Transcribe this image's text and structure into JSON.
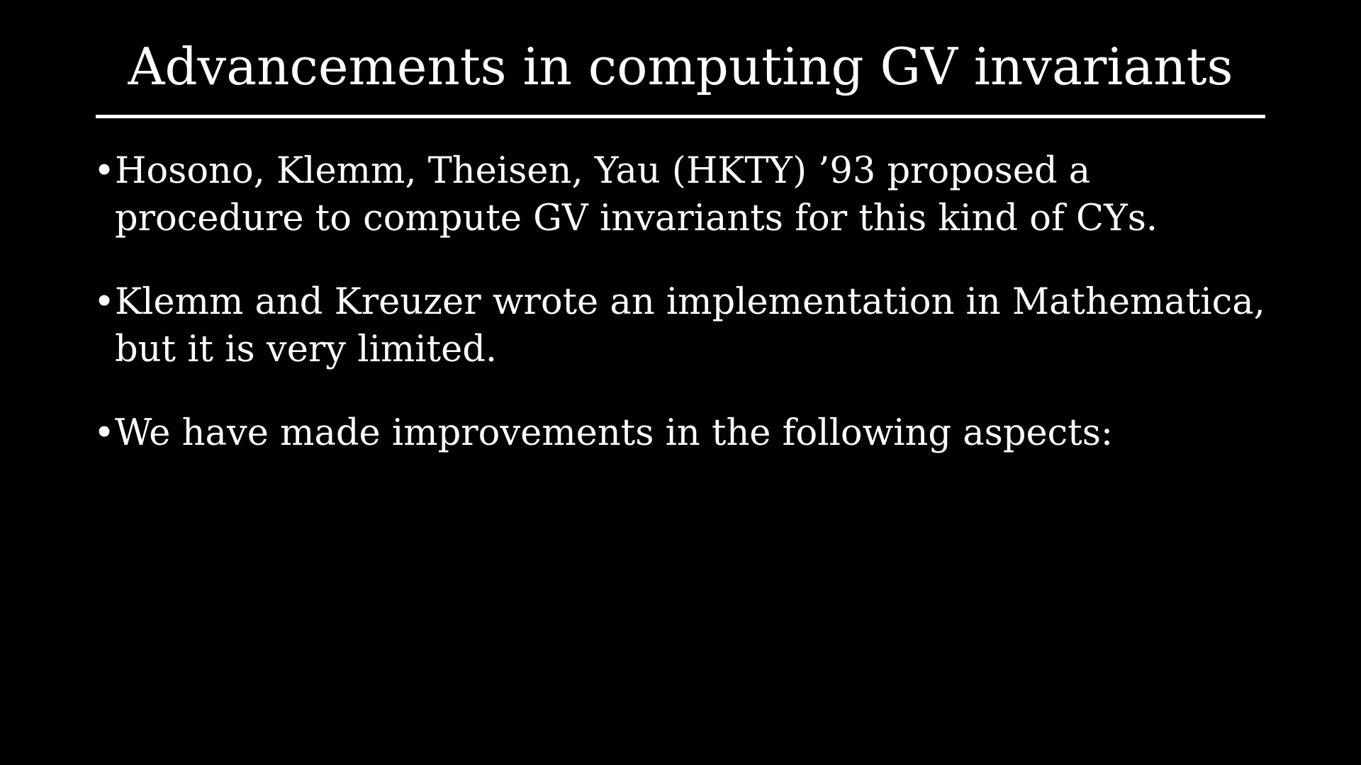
{
  "slide": {
    "title": "Advancements in computing GV invariants",
    "bullet_symbol": "•",
    "bullets": [
      {
        "text": "Hosono, Klemm, Theisen, Yau (HKTY) ’93 proposed a procedure to compute GV invariants for this kind of CYs."
      },
      {
        "text": "Klemm and Kreuzer wrote an implementation in Mathematica, but it is very limited."
      },
      {
        "text": "We have made improvements in the following aspects:"
      }
    ]
  },
  "colors": {
    "background": "#000000",
    "text": "#ffffff"
  }
}
